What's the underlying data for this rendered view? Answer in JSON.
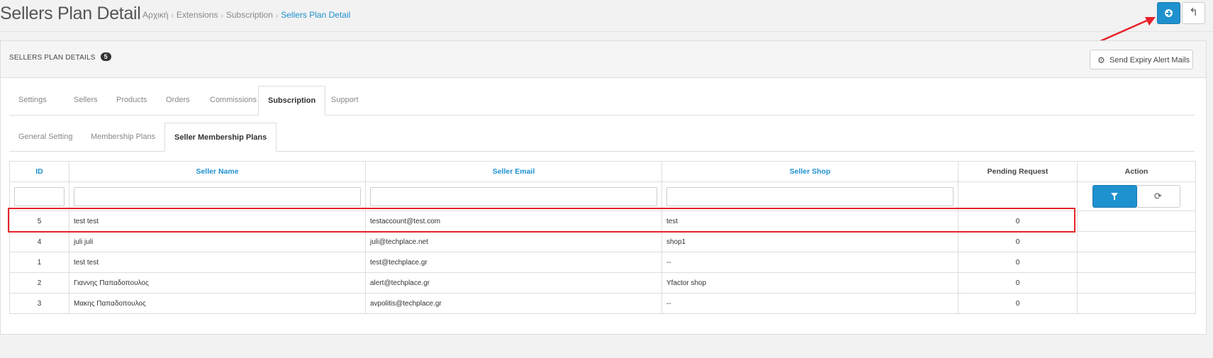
{
  "header": {
    "title": "Sellers Plan Detail",
    "breadcrumb": [
      "Αρχική",
      "Extensions",
      "Subscription",
      "Sellers Plan Detail"
    ],
    "add_icon": "plus-circle-icon",
    "back_icon": "reply-icon"
  },
  "panel": {
    "title": "SELLERS PLAN DETAILS",
    "count": "5",
    "send_alert_label": "Send Expiry Alert Mails"
  },
  "main_tabs": [
    "Settings",
    "Sellers",
    "Products",
    "Orders",
    "Commissions",
    "Subscription",
    "Support"
  ],
  "main_tab_active": "Subscription",
  "sub_tabs": [
    "General Setting",
    "Membership Plans",
    "Seller Membership Plans"
  ],
  "sub_tab_active": "Seller Membership Plans",
  "table": {
    "columns": [
      "ID",
      "Seller Name",
      "Seller Email",
      "Seller Shop",
      "Pending Request",
      "Action"
    ],
    "rows": [
      {
        "id": "5",
        "name": "test test",
        "email": "testaccount@test.com",
        "shop": "test",
        "pending": "0"
      },
      {
        "id": "4",
        "name": "juli juli",
        "email": "juli@techplace.net",
        "shop": "shop1",
        "pending": "0"
      },
      {
        "id": "1",
        "name": "test test",
        "email": "test@techplace.gr",
        "shop": "--",
        "pending": "0"
      },
      {
        "id": "2",
        "name": "Γιαννης Παπαδοπουλος",
        "email": "alert@techplace.gr",
        "shop": "Yfactor shop",
        "pending": "0"
      },
      {
        "id": "3",
        "name": "Μακης Παπαδοπουλος",
        "email": "avpolitis@techplace.gr",
        "shop": "--",
        "pending": "0"
      }
    ]
  },
  "colors": {
    "accent": "#1e91cf",
    "annotation": "#e8202a"
  }
}
